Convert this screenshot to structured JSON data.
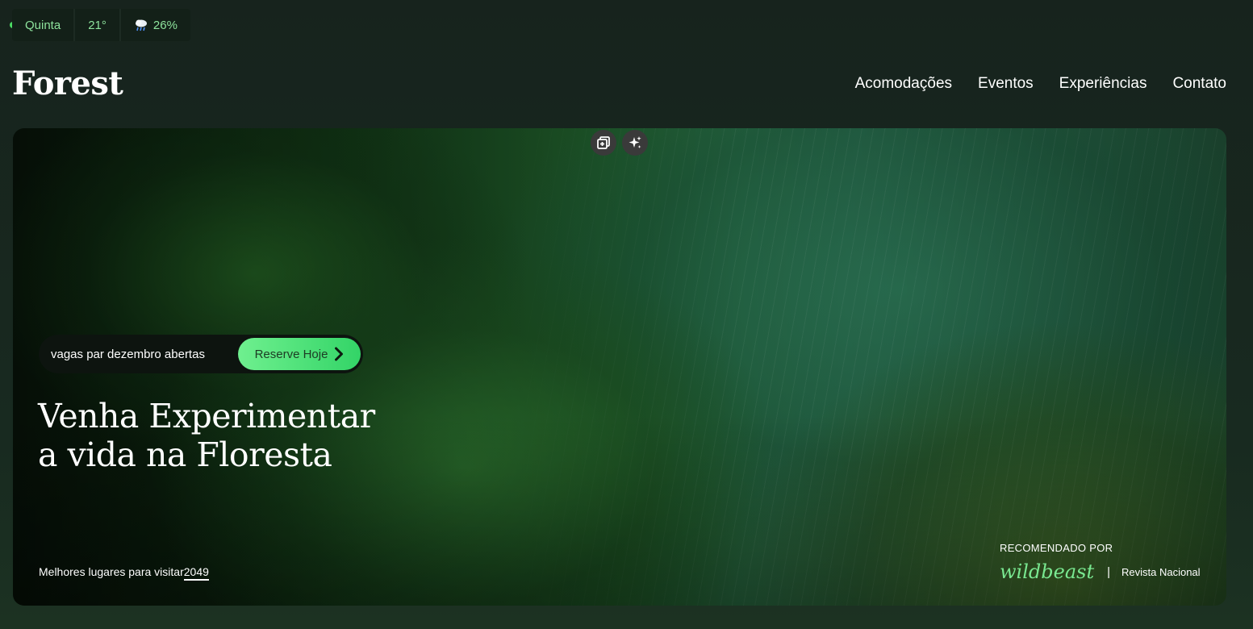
{
  "weather": {
    "day": "Quinta",
    "temperature": "21°",
    "rain_chance": "26%",
    "icon": "rain-cloud-icon",
    "accent_color": "#8ee39d"
  },
  "header": {
    "logo": "Forest",
    "nav": [
      "Acomodações",
      "Eventos",
      "Experiências",
      "Contato"
    ]
  },
  "hero": {
    "tools": [
      "copy-image-icon",
      "sparkle-icon"
    ],
    "promo_text": "vagas par dezembro abertas",
    "reserve_label": "Reserve Hoje",
    "title_line1": "Venha Experimentar",
    "title_line2": "a vida na Floresta",
    "best_places_label": "Melhores lugares para visitar",
    "best_places_year": "2049",
    "recommended_label": "RECOMENDADO POR",
    "brand_primary": "wildbeast",
    "separator": "|",
    "brand_secondary": "Revista Nacional",
    "brand_color": "#79e890"
  }
}
